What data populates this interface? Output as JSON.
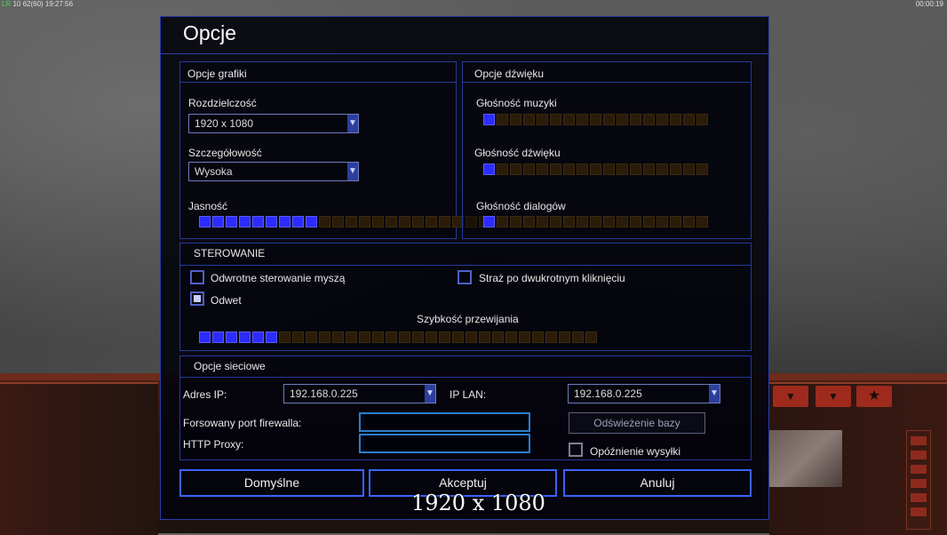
{
  "hud": {
    "top_left": "LR 10 62(60) 19:27:56",
    "top_left_green": "LR",
    "top_left_rest": " 10 62(60) 19:27:56",
    "top_right": "00:00:19"
  },
  "dialog": {
    "title": "Opcje",
    "graphics": {
      "title": "Opcje grafiki",
      "resolution_label": "Rozdzielczość",
      "resolution_value": "1920 x 1080",
      "detail_label": "Szczegółowość",
      "detail_value": "Wysoka",
      "brightness_label": "Jasność",
      "brightness_level": 9,
      "brightness_max": 22
    },
    "sound": {
      "title": "Opcje dźwięku",
      "music_label": "Głośność muzyki",
      "music_level": 1,
      "sfx_label": "Głośność dźwięku",
      "sfx_level": 1,
      "dialog_label": "Głośność dialogów",
      "dialog_level": 1,
      "max": 17
    },
    "controls": {
      "title": "STEROWANIE",
      "invert_mouse_label": "Odwrotne sterowanie myszą",
      "invert_mouse_checked": false,
      "guard_label": "Straż po dwukrotnym kliknięciu",
      "guard_checked": false,
      "retaliation_label": "Odwet",
      "retaliation_checked": true,
      "scroll_label": "Szybkość przewijania",
      "scroll_level": 6,
      "scroll_max": 39
    },
    "network": {
      "title": "Opcje sieciowe",
      "ip_label": "Adres IP:",
      "ip_value": "192.168.0.225",
      "lan_label": "IP LAN:",
      "lan_value": "192.168.0.225",
      "firewall_label": "Forsowany port firewalla:",
      "firewall_value": "",
      "proxy_label": "HTTP Proxy:",
      "proxy_value": "",
      "refresh_label": "Odświeżenie bazy",
      "send_delay_label": "Opóźnienie wysyłki",
      "send_delay_checked": false
    },
    "buttons": {
      "defaults": "Domyślne",
      "accept": "Akceptuj",
      "cancel": "Anuluj"
    },
    "overlay_resolution": "1920 x 1080"
  },
  "colors": {
    "accent_blue": "#2c2cff",
    "frame_blue": "#243a9a",
    "slider_off": "#2a1c08"
  },
  "icons": {
    "dropdown": "triangle-down",
    "hud_star": "star"
  }
}
